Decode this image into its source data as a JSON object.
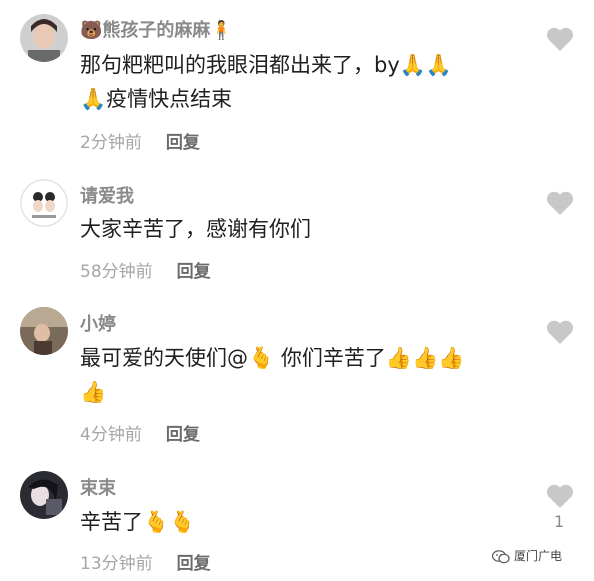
{
  "comments": [
    {
      "username": "熊孩子的麻麻",
      "name_prefix_emoji": "🐻",
      "name_suffix_emoji": "🧍",
      "text_line1": "那句粑粑叫的我眼泪都出来了，by🙏🙏",
      "text_line2": "🙏疫情快点结束",
      "time": "2分钟前",
      "reply_label": "回复",
      "likes": ""
    },
    {
      "username": "请爱我",
      "text_line1": "大家辛苦了，感谢有你们",
      "time": "58分钟前",
      "reply_label": "回复",
      "likes": ""
    },
    {
      "username": "小婷",
      "text_line1": "最可爱的天使们@🫰 你们辛苦了👍👍👍",
      "text_line2": "👍",
      "time": "4分钟前",
      "reply_label": "回复",
      "likes": ""
    },
    {
      "username": "束束",
      "text_line1": "辛苦了🫰🫰",
      "time": "13分钟前",
      "reply_label": "回复",
      "likes": "1"
    }
  ],
  "watermark": {
    "text": "厦门广电",
    "icon": "wechat-icon"
  },
  "colors": {
    "heart": "#c8c8c8",
    "username": "#8a8a8a",
    "meta": "#a6a6a6"
  }
}
